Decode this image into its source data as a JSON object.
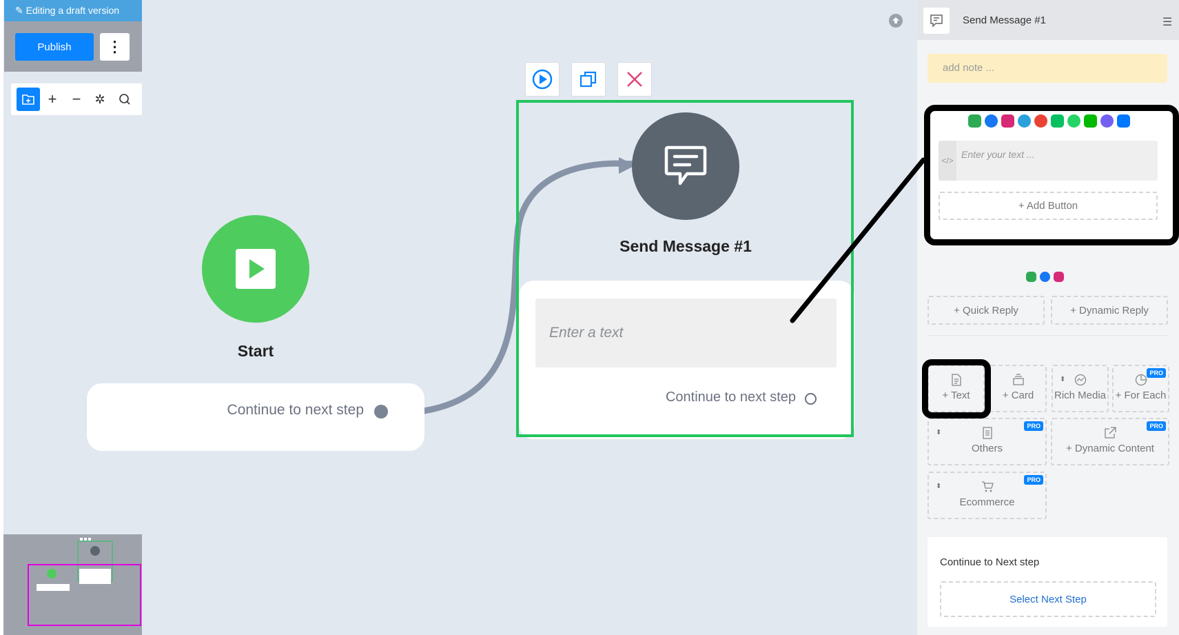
{
  "draft": {
    "banner": "Editing a draft version",
    "publish_label": "Publish",
    "more_icon": "more-vertical-icon"
  },
  "toolbar": {
    "icons": [
      "add-folder-icon",
      "zoom-in-icon",
      "zoom-out-icon",
      "magic-wand-icon",
      "search-icon"
    ]
  },
  "start_node": {
    "title": "Start",
    "continue_label": "Continue to next step"
  },
  "message_node": {
    "title": "Send Message #1",
    "placeholder": "Enter a text",
    "continue_label": "Continue to next step"
  },
  "panel": {
    "title": "Send Message #1",
    "note_placeholder": "add note ...",
    "text_placeholder": "Enter your text ...",
    "add_button_label": "+ Add Button",
    "quick_reply_label": "+ Quick Reply",
    "dynamic_reply_label": "+ Dynamic Reply",
    "tiles": {
      "text": "+ Text",
      "card": "+ Card",
      "rich_media": "Rich Media",
      "for_each": "+ For Each",
      "others": "Others",
      "dynamic_content": "+ Dynamic Content",
      "ecommerce": "Ecommerce"
    },
    "pro_badge": "PRO",
    "next_step_title": "Continue to Next step",
    "select_next_label": "Select Next Step"
  },
  "colors": {
    "accent": "#0a84ff",
    "selected_border": "#22c55e",
    "start_green": "#4fcc5e",
    "node_gray": "#5b6570"
  }
}
